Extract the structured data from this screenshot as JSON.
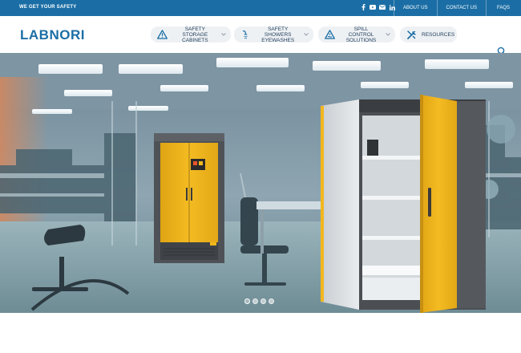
{
  "topbar": {
    "tagline": "WE GET YOUR SAFETY",
    "social": [
      "facebook-icon",
      "youtube-icon",
      "email-icon",
      "linkedin-icon"
    ],
    "links": [
      "ABOUT US",
      "CONTACT US",
      "FAQS"
    ]
  },
  "header": {
    "logo": "LABNORI",
    "menu": [
      {
        "label": "SAFETY STORAGE\nCABINETS",
        "icon": "warning-triangle-icon"
      },
      {
        "label": "SAFETY SHOWERS\nEYEWASHES",
        "icon": "shower-icon"
      },
      {
        "label": "SPILL CONTROL\nSOLUTIONS",
        "icon": "spill-icon"
      },
      {
        "label": "RESOURCES",
        "icon": "tools-icon"
      }
    ],
    "search_icon": "search-icon"
  },
  "hero": {
    "slide_count": 4,
    "active_slide": 1
  },
  "colors": {
    "brand_blue": "#1b6ea5",
    "cabinet_yellow": "#f2b71e",
    "cabinet_grey": "#4e5257"
  }
}
